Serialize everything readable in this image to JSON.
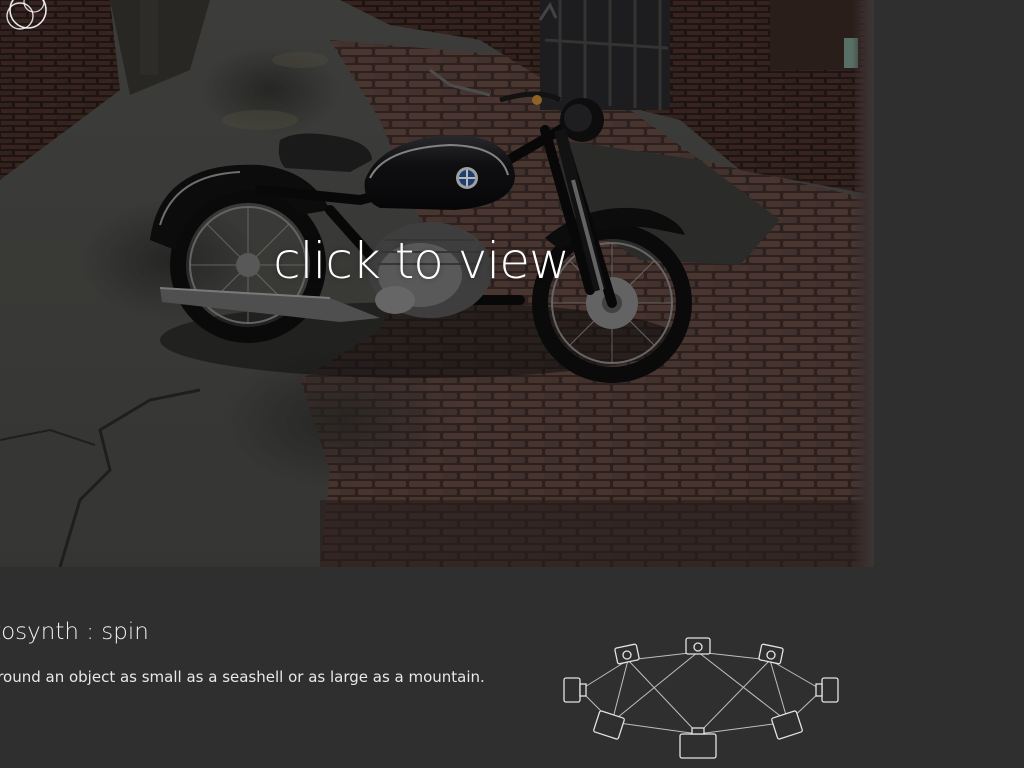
{
  "viewer": {
    "overlay_label": "click to view"
  },
  "info": {
    "title": "otosynth : spin",
    "description": "around an object as small as a seashell or as large as a mountain."
  },
  "icons": {
    "logo": "photosynth-logo-icon",
    "diagram": "camera-spin-diagram-icon"
  },
  "colors": {
    "background": "#2f2f2f",
    "text": "#f2f2f2"
  }
}
